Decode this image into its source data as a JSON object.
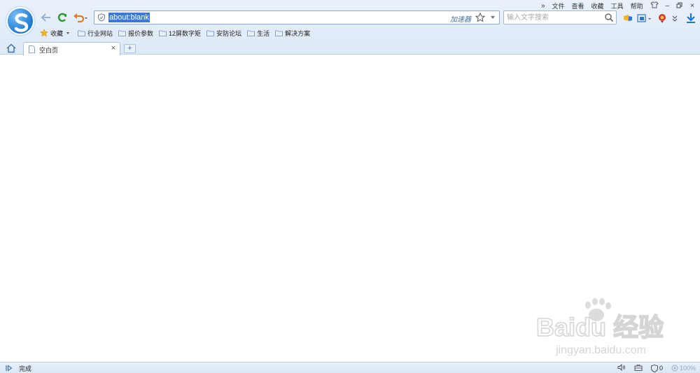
{
  "menu": {
    "more": "»",
    "items": [
      "文件",
      "查看",
      "收藏",
      "工具",
      "帮助"
    ],
    "minimize": "–",
    "restore": "▭",
    "close": "×"
  },
  "address": {
    "url": "about:blank",
    "accelerator": "加速器"
  },
  "search": {
    "placeholder": "输入文字搜索"
  },
  "bookmarks": {
    "favorites_label": "收藏",
    "items": [
      "行业网站",
      "报价参数",
      "12屏数字矩",
      "安防论坛",
      "生活",
      "解决方案"
    ]
  },
  "tabs": [
    {
      "title": "空白页",
      "close": "×"
    }
  ],
  "new_tab": "+",
  "status": {
    "text": "完成",
    "shield_count": "0",
    "zoom": "100%"
  },
  "watermark": {
    "brand": "Baidu 经验",
    "url": "jingyan.baidu.com"
  },
  "colors": {
    "chrome_bg": "#e3edf9",
    "url_highlight": "#3b79d8",
    "accent": "#1b78cf"
  }
}
